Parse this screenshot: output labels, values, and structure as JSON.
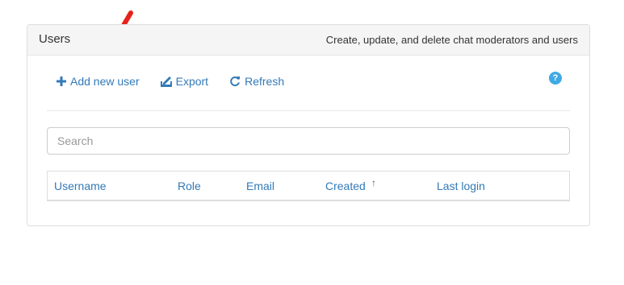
{
  "panel": {
    "title": "Users",
    "description": "Create, update, and delete chat moderators and users"
  },
  "toolbar": {
    "add_label": "Add new user",
    "export_label": "Export",
    "refresh_label": "Refresh",
    "help_label": "?"
  },
  "search": {
    "placeholder": "Search",
    "value": ""
  },
  "table": {
    "columns": [
      "Username",
      "Role",
      "Email",
      "Created",
      "Last login"
    ],
    "sort_indicator": "↑"
  },
  "colors": {
    "link": "#337ab7",
    "help": "#3fa9e4",
    "annotation_arrow": "#e5231b"
  },
  "icons": {
    "add": "plus-icon",
    "export": "export-icon",
    "refresh": "refresh-icon",
    "help": "question-circle-icon"
  }
}
